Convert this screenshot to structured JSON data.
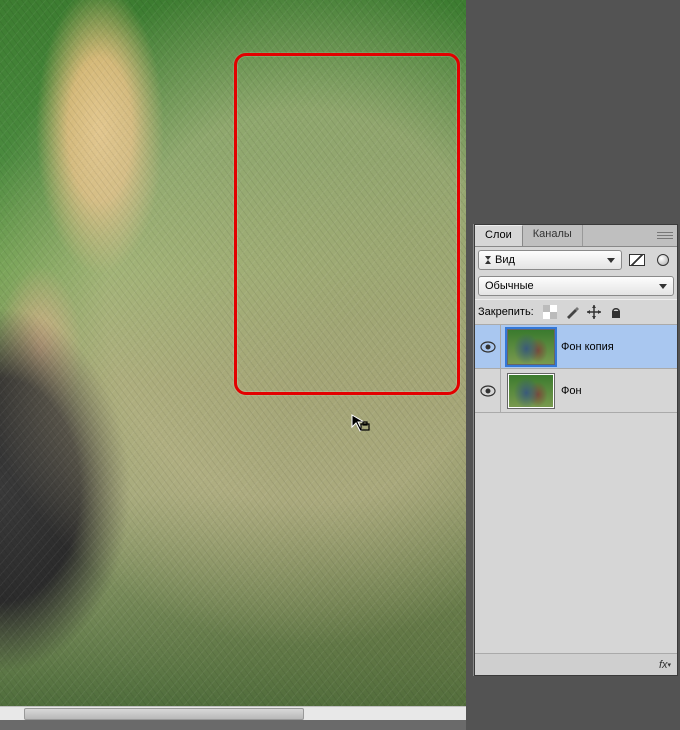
{
  "panel": {
    "tabs": [
      {
        "label": "Слои",
        "active": true
      },
      {
        "label": "Каналы",
        "active": false
      }
    ],
    "kind_dropdown": "Вид",
    "blend_dropdown": "Обычные",
    "lock_label": "Закрепить:"
  },
  "layers": [
    {
      "name": "Фон копия",
      "selected": true,
      "visible": true
    },
    {
      "name": "Фон",
      "selected": false,
      "visible": true
    }
  ],
  "footer_fx": "fx"
}
